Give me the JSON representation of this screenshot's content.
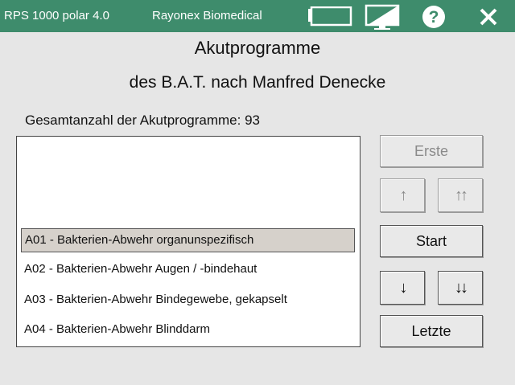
{
  "titlebar": {
    "app_name": "RPS 1000 polar 4.0",
    "company": "Rayonex Biomedical",
    "icons": [
      "battery-icon",
      "display-icon",
      "help-icon",
      "close-icon"
    ]
  },
  "header": {
    "title": "Akutprogramme",
    "subtitle": "des B.A.T. nach Manfred Denecke",
    "count_label": "Gesamtanzahl der Akutprogramme: 93"
  },
  "list": {
    "items": [
      "A01 - Bakterien-Abwehr organunspezifisch",
      "A02 - Bakterien-Abwehr Augen / -bindehaut",
      "A03 - Bakterien-Abwehr Bindegewebe, gekapselt",
      "A04 - Bakterien-Abwehr Blinddarm"
    ],
    "selected_index": 0
  },
  "buttons": {
    "first": "Erste",
    "up": "↑",
    "page_up": "↑↑",
    "start": "Start",
    "down": "↓",
    "page_down": "↓↓",
    "last": "Letzte"
  },
  "colors": {
    "titlebar": "#3e8c6c",
    "background": "#e6e6e6",
    "selection": "#d6d1cb"
  }
}
